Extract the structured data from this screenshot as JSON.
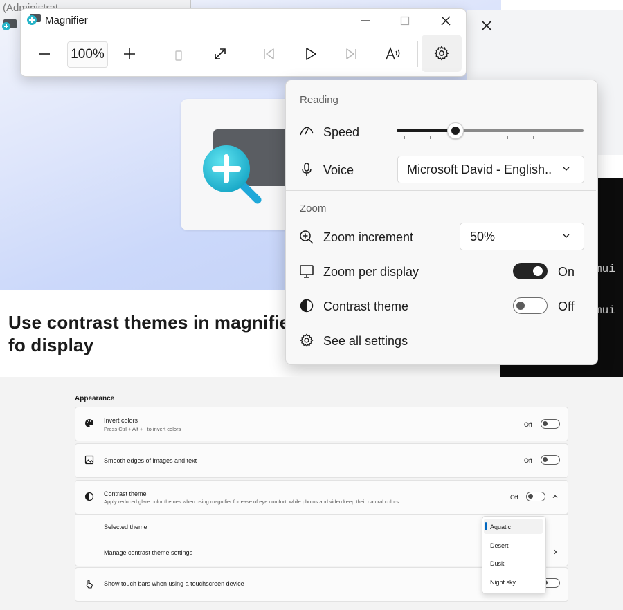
{
  "background": {
    "admin_title": "(Administrat",
    "article_title": "Use contrast themes in magnifier fo display",
    "terminal_lines": [
      "mui",
      "mui"
    ]
  },
  "magnifier": {
    "title": "Magnifier",
    "zoom_level": "100%",
    "icons": [
      "zoom-out-icon",
      "zoom-in-icon",
      "lens-icon",
      "fullscreen-icon",
      "previous-icon",
      "play-icon",
      "next-icon",
      "read-aloud-icon",
      "settings-icon"
    ]
  },
  "flyout": {
    "reading_header": "Reading",
    "speed_label": "Speed",
    "speed_level": 0.31,
    "voice_label": "Voice",
    "voice_value": "Microsoft David - English...",
    "zoom_header": "Zoom",
    "zoom_increment_label": "Zoom increment",
    "zoom_increment_value": "50%",
    "zoom_per_display_label": "Zoom per display",
    "zoom_per_display_state": "On",
    "contrast_theme_label": "Contrast theme",
    "contrast_theme_state": "Off",
    "see_all_label": "See all settings"
  },
  "settings": {
    "section_title": "Appearance",
    "invert": {
      "title": "Invert colors",
      "subtitle": "Press Ctrl + Alt + I to invert colors",
      "state": "Off"
    },
    "smooth": {
      "title": "Smooth edges of images and text",
      "state": "Off"
    },
    "contrast": {
      "title": "Contrast theme",
      "subtitle": "Apply reduced glare color themes when using magnifier for ease of eye comfort, while photos and video keep their natural colors.",
      "state": "Off"
    },
    "selected_theme_label": "Selected theme",
    "manage_label": "Manage contrast theme settings",
    "touch_label": "Show touch bars when using a touchscreen device",
    "theme_options": [
      "Aquatic",
      "Desert",
      "Dusk",
      "Night sky"
    ],
    "selected_theme": "Aquatic"
  },
  "colors": {
    "accent": "#0067c0",
    "toggle_on": "#242424",
    "terminal_bg": "#0c0c0c",
    "magnifier_icon": "#27b5c9"
  }
}
